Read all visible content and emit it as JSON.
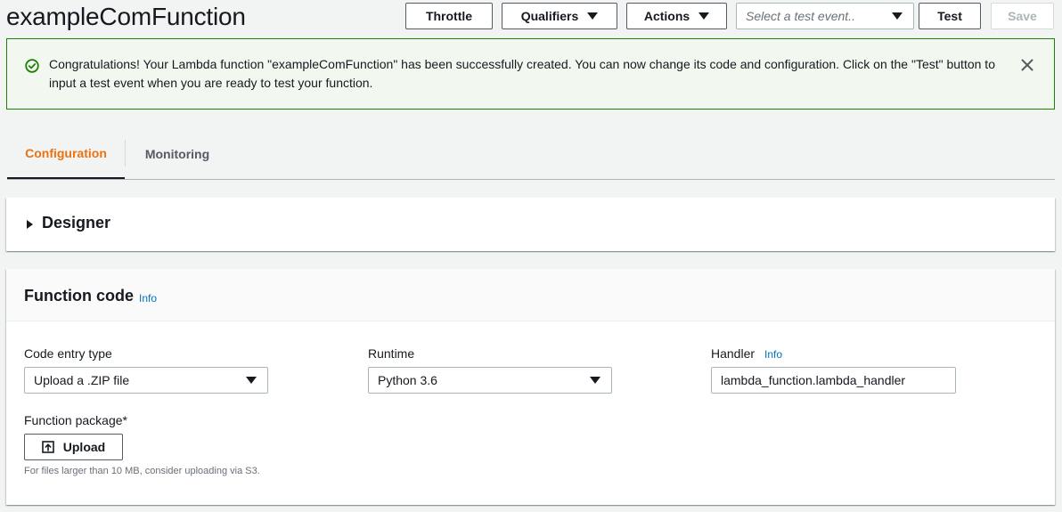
{
  "header": {
    "title": "exampleComFunction",
    "throttle_label": "Throttle",
    "qualifiers_label": "Qualifiers",
    "actions_label": "Actions",
    "test_event_placeholder": "Select a test event..",
    "test_label": "Test",
    "save_label": "Save"
  },
  "banner": {
    "message": "Congratulations! Your Lambda function \"exampleComFunction\" has been successfully created. You can now change its code and configuration. Click on the \"Test\" button to input a test event when you are ready to test your function.",
    "icon": "check-circle-icon",
    "close_icon": "close-icon",
    "color": "#1d8102"
  },
  "tabs": [
    {
      "label": "Configuration",
      "active": true
    },
    {
      "label": "Monitoring",
      "active": false
    }
  ],
  "designer": {
    "title": "Designer"
  },
  "function_code": {
    "title": "Function code",
    "info_label": "Info",
    "code_entry_type": {
      "label": "Code entry type",
      "value": "Upload a .ZIP file"
    },
    "runtime": {
      "label": "Runtime",
      "value": "Python 3.6"
    },
    "handler": {
      "label": "Handler",
      "info_label": "Info",
      "value": "lambda_function.lambda_handler"
    },
    "package": {
      "label": "Function package*",
      "upload_label": "Upload",
      "hint": "For files larger than 10 MB, consider uploading via S3."
    }
  },
  "colors": {
    "accent": "#ec7211",
    "link": "#0073bb",
    "success": "#1d8102"
  }
}
